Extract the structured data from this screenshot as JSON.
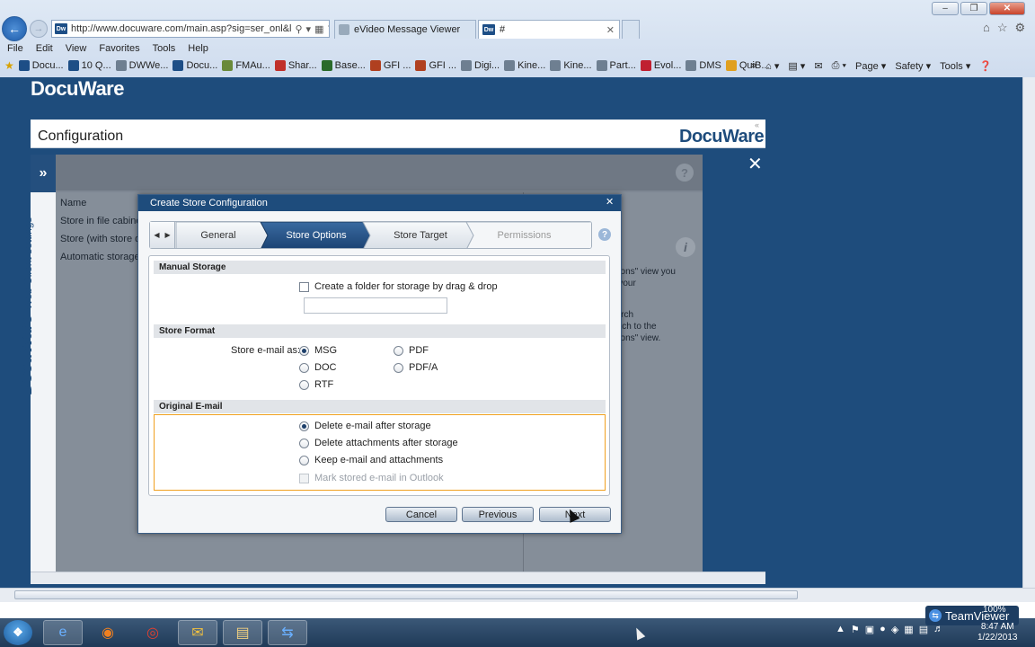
{
  "browser": {
    "address": "http://www.docuware.com/main.asp?sig=ser_onl&l",
    "tabs": [
      {
        "label": "eVideo Message Viewer"
      },
      {
        "label": "#"
      }
    ],
    "menu": [
      "File",
      "Edit",
      "View",
      "Favorites",
      "Tools",
      "Help"
    ],
    "favorites": [
      "Docu...",
      "10 Q...",
      "DWWe...",
      "Docu...",
      "FMAu...",
      "Shar...",
      "Base...",
      "GFI ...",
      "GFI ...",
      "Digi...",
      "Kine...",
      "Kine...",
      "Part...",
      "Evol...",
      "DMS",
      "QuiB..."
    ],
    "fav_colors": [
      "#1d4e86",
      "#1d4e86",
      "#6e7f91",
      "#1d4e86",
      "#6a8a3a",
      "#c0302a",
      "#2a6a2a",
      "#b04020",
      "#b04020",
      "#6e7f91",
      "#6e7f91",
      "#6e7f91",
      "#6e7f91",
      "#c02030",
      "#6e7f91",
      "#e0a020"
    ],
    "commands": [
      "Page",
      "Safety",
      "Tools"
    ]
  },
  "app": {
    "brand": "DocuWare",
    "panel_title": "Configuration",
    "side_brand": "DocuWare",
    "side_label": "Web Client settings",
    "list_header": "Name",
    "list_items": [
      "Store in file cabinet",
      "Store (with store d",
      "Automatic storage"
    ],
    "right_text": [
      "ations\" view you",
      "b your",
      "earch",
      "witch to the",
      "ations\" view."
    ]
  },
  "dialog": {
    "title": "Create Store Configuration",
    "steps": [
      {
        "label": "General",
        "state": "done"
      },
      {
        "label": "Store Options",
        "state": "active"
      },
      {
        "label": "Store Target",
        "state": "pending"
      },
      {
        "label": "Permissions",
        "state": "disabled"
      }
    ],
    "manual_storage": {
      "header": "Manual Storage",
      "checkbox_label": "Create a folder for storage by drag & drop",
      "folder_value": ""
    },
    "store_format": {
      "header": "Store Format",
      "label": "Store e-mail as:",
      "options": [
        "MSG",
        "PDF",
        "DOC",
        "PDF/A",
        "RTF"
      ],
      "selected": "MSG"
    },
    "original_email": {
      "header": "Original E-mail",
      "options": [
        "Delete e-mail after storage",
        "Delete attachments after storage",
        "Keep e-mail and attachments"
      ],
      "selected": "Delete e-mail after storage",
      "mark_label": "Mark stored e-mail in Outlook"
    },
    "buttons": {
      "cancel": "Cancel",
      "previous": "Previous",
      "next": "Next"
    }
  },
  "taskbar": {
    "clock_time": "8:47 AM",
    "clock_date": "1/22/2013",
    "teamviewer": "TeamViewer",
    "zoom": "100%"
  },
  "colors": {
    "brand_blue": "#1e4c7c",
    "step_active": "#1e4c7c",
    "highlight": "#f0a020"
  }
}
